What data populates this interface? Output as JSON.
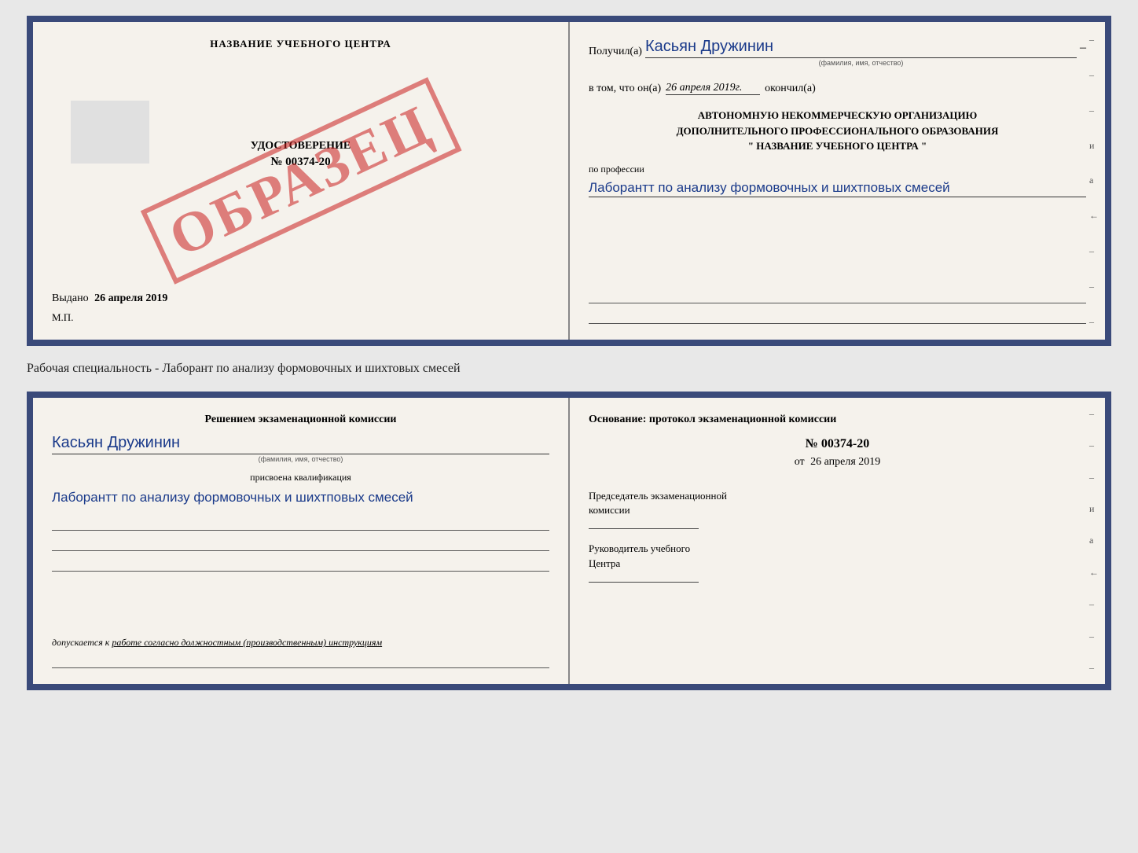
{
  "top_card": {
    "left": {
      "title": "НАЗВАНИЕ УЧЕБНОГО ЦЕНТРА",
      "obrazec": "ОБРАЗЕЦ",
      "cert_label": "УДОСТОВЕРЕНИЕ",
      "cert_number": "№ 00374-20",
      "vydano": "Выдано",
      "vydano_date": "26 апреля 2019",
      "mp": "М.П."
    },
    "right": {
      "poluchil_prefix": "Получил(а)",
      "poluchil_name": "Касьян Дружинин",
      "fio_label": "(фамилия, имя, отчество)",
      "dash": "–",
      "vtom_prefix": "в том, что он(а)",
      "vtom_date": "26 апреля 2019г.",
      "okonchil": "окончил(а)",
      "org_line1": "АВТОНОМНУЮ НЕКОММЕРЧЕСКУЮ ОРГАНИЗАЦИЮ",
      "org_line2": "ДОПОЛНИТЕЛЬНОГО ПРОФЕССИОНАЛЬНОГО ОБРАЗОВАНИЯ",
      "org_line3": "\" НАЗВАНИЕ УЧЕБНОГО ЦЕНТРА \"",
      "po_professii": "по профессии",
      "profession": "Лаборантт по анализу формовочных и шихтповых смесей",
      "dash2": "–",
      "lines": [
        "",
        "",
        "–",
        "–",
        "–"
      ]
    }
  },
  "specialty_text": "Рабочая специальность - Лаборант по анализу формовочных и шихтовых смесей",
  "bottom_card": {
    "left": {
      "resheniem_title": "Решением экзаменационной комиссии",
      "name": "Касьян Дружинин",
      "fio_label": "(фамилия, имя, отчество)",
      "prisvoena_label": "присвоена квалификация",
      "qualification": "Лаборантт по анализу формовочных и шихтповых смесей",
      "dopuskaetsya_prefix": "допускается к",
      "dopuskaetsya_text": "работе согласно должностным (производственным) инструкциям"
    },
    "right": {
      "osnovanie": "Основание: протокол экзаменационной комиссии",
      "protocol_number": "№ 00374-20",
      "ot_prefix": "от",
      "ot_date": "26 апреля 2019",
      "predsedatel_line1": "Председатель экзаменационной",
      "predsedatel_line2": "комиссии",
      "rukovoditel_line1": "Руководитель учебного",
      "rukovoditel_line2": "Центра",
      "side_dashes": [
        "–",
        "–",
        "–",
        "и",
        "а",
        "←",
        "–",
        "–",
        "–"
      ]
    }
  }
}
